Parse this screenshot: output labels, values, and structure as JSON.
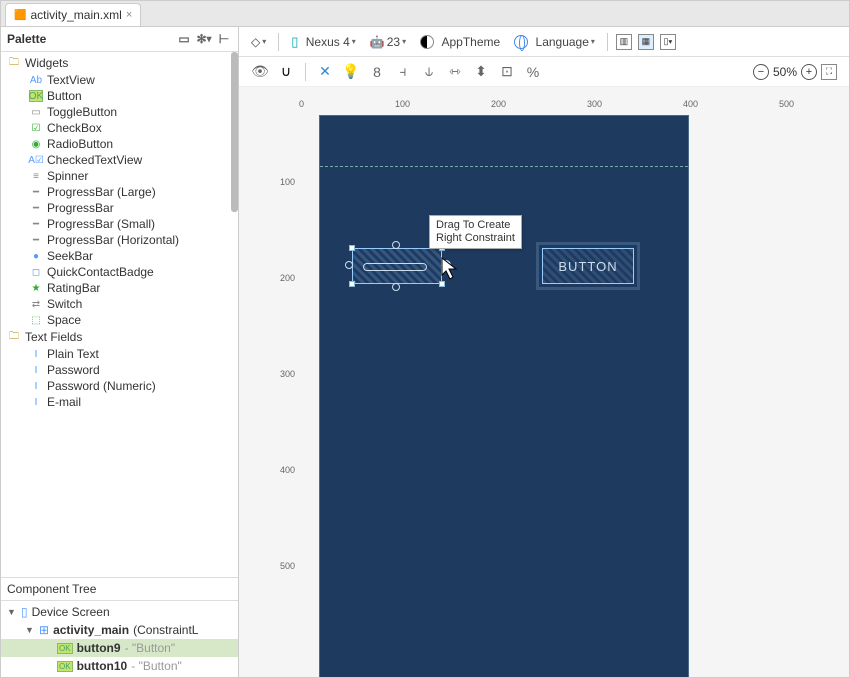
{
  "tab": {
    "title": "activity_main.xml"
  },
  "palette": {
    "title": "Palette",
    "groups": [
      {
        "label": "Widgets",
        "items": [
          {
            "icon": "Ab",
            "cls": "bluebox",
            "label": "TextView"
          },
          {
            "icon": "OK",
            "cls": "ok",
            "label": "Button"
          },
          {
            "icon": "▭",
            "cls": "graybox",
            "label": "ToggleButton"
          },
          {
            "icon": "☑",
            "cls": "greenbox",
            "label": "CheckBox"
          },
          {
            "icon": "◉",
            "cls": "greenbox",
            "label": "RadioButton"
          },
          {
            "icon": "A☑",
            "cls": "bluebox",
            "label": "CheckedTextView"
          },
          {
            "icon": "≡",
            "cls": "graybox",
            "label": "Spinner"
          },
          {
            "icon": "━",
            "cls": "graybox",
            "label": "ProgressBar (Large)"
          },
          {
            "icon": "━",
            "cls": "graybox",
            "label": "ProgressBar"
          },
          {
            "icon": "━",
            "cls": "graybox",
            "label": "ProgressBar (Small)"
          },
          {
            "icon": "━",
            "cls": "graybox",
            "label": "ProgressBar (Horizontal)"
          },
          {
            "icon": "●",
            "cls": "bluebox",
            "label": "SeekBar"
          },
          {
            "icon": "◻",
            "cls": "bluebox",
            "label": "QuickContactBadge"
          },
          {
            "icon": "★",
            "cls": "greenbox",
            "label": "RatingBar"
          },
          {
            "icon": "⇄",
            "cls": "graybox",
            "label": "Switch"
          },
          {
            "icon": "⬚",
            "cls": "greenbox",
            "label": "Space"
          }
        ]
      },
      {
        "label": "Text Fields",
        "items": [
          {
            "icon": "I",
            "cls": "bluebox",
            "label": "Plain Text"
          },
          {
            "icon": "I",
            "cls": "bluebox",
            "label": "Password"
          },
          {
            "icon": "I",
            "cls": "bluebox",
            "label": "Password (Numeric)"
          },
          {
            "icon": "I",
            "cls": "bluebox",
            "label": "E-mail"
          }
        ]
      }
    ]
  },
  "componentTree": {
    "title": "Component Tree",
    "root": "Device Screen",
    "layout_name": "activity_main",
    "layout_type": "(ConstraintL",
    "children": [
      {
        "name": "button9",
        "sub": " - \"Button\"",
        "selected": true
      },
      {
        "name": "button10",
        "sub": " - \"Button\"",
        "selected": false
      }
    ]
  },
  "toolbar": {
    "device": "Nexus 4",
    "api": "23",
    "theme": "AppTheme",
    "language": "Language",
    "autoconnect_num": "8"
  },
  "zoom": {
    "level": "50%"
  },
  "ruler_h": [
    "0",
    "100",
    "200",
    "300",
    "400",
    "500"
  ],
  "ruler_v": [
    "100",
    "200",
    "300",
    "400",
    "500"
  ],
  "canvas": {
    "button_label": "BUTTON",
    "tooltip_l1": "Drag To Create",
    "tooltip_l2": "Right Constraint"
  }
}
